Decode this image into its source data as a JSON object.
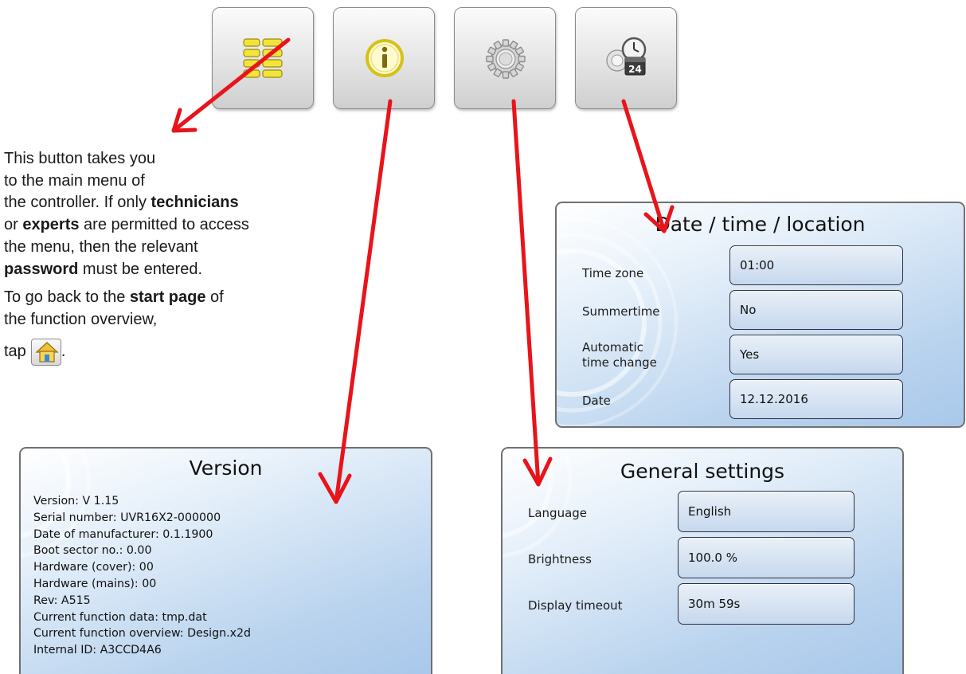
{
  "top_buttons": [
    {
      "icon": "main-menu-icon"
    },
    {
      "icon": "info-icon"
    },
    {
      "icon": "settings-gear-icon"
    },
    {
      "icon": "date-time-calendar-icon"
    }
  ],
  "description": {
    "line1": "This button takes you",
    "line2": "to the main menu of",
    "line3a": "the controller. If only ",
    "line3b": "technicians",
    "line4a": "or ",
    "line4b": "experts",
    "line4c": " are permitted to access",
    "line5": "the menu, then the relevant",
    "line6a": "password",
    "line6b": " must be entered.",
    "line7a": "To go back to the ",
    "line7b": "start page",
    "line7c": " of",
    "line8": "the function overview,",
    "tap_word": "tap",
    "tap_after": " .",
    "home_icon": "home-icon"
  },
  "datetime_panel": {
    "title": "Date / time / location",
    "rows": [
      {
        "label": "Time zone",
        "value": "01:00"
      },
      {
        "label": "Summertime",
        "value": "No"
      },
      {
        "label_line1": "Automatic",
        "label_line2": "time change",
        "value": "Yes"
      },
      {
        "label": "Date",
        "value": "12.12.2016"
      }
    ]
  },
  "version_panel": {
    "title": "Version",
    "lines": [
      "Version: V 1.15",
      "Serial number: UVR16X2-000000",
      "Date of manufacturer: 0.1.1900",
      "Boot sector no.: 0.00",
      "Hardware (cover): 00",
      "Hardware (mains): 00",
      "Rev: A515",
      "Current function data: tmp.dat",
      "Current function overview: Design.x2d",
      "Internal ID: A3CCD4A6"
    ]
  },
  "general_panel": {
    "title": "General settings",
    "rows": [
      {
        "label": "Language",
        "value": "English"
      },
      {
        "label": "Brightness",
        "value": "100.0 %"
      },
      {
        "label": "Display timeout",
        "value": "30m 59s"
      }
    ]
  },
  "colors": {
    "arrow": "#e8141a",
    "menu_icon": "#f2e23a",
    "panel_border": "#707070"
  }
}
